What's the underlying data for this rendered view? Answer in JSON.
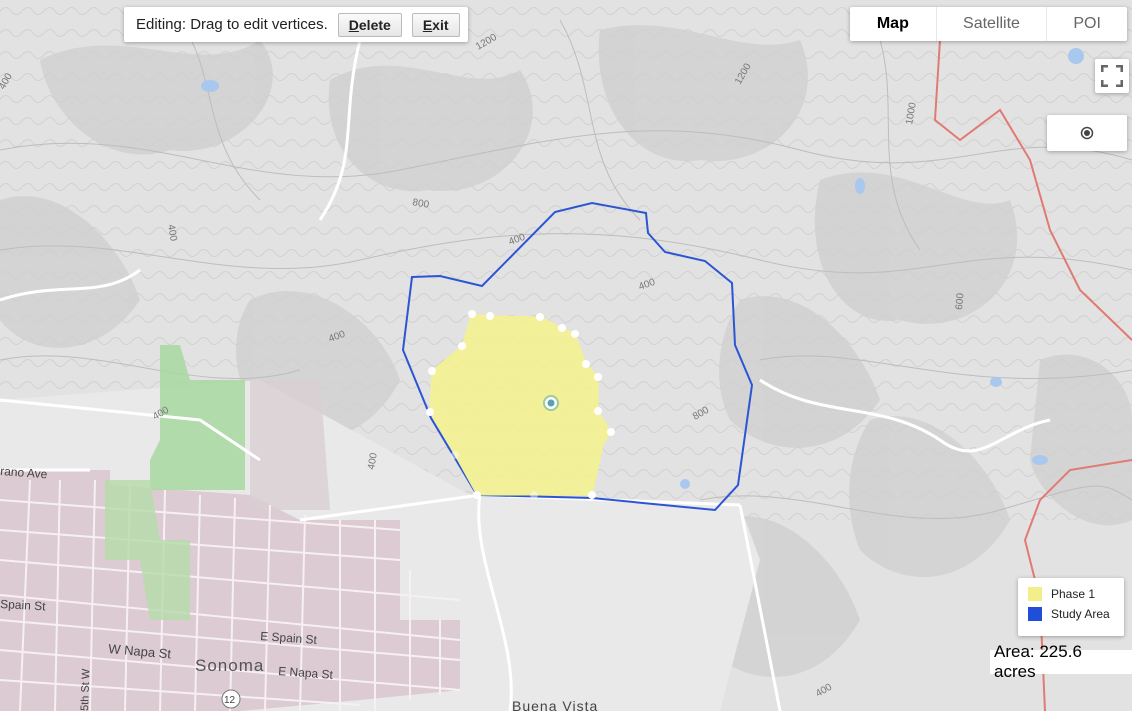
{
  "edit_toolbar": {
    "hint": "Editing: Drag to edit vertices.",
    "delete_label": "Delete",
    "exit_label": "Exit"
  },
  "map_type": {
    "options": [
      "Map",
      "Satellite",
      "POI"
    ],
    "active": "Map"
  },
  "controls": {
    "fullscreen_icon": "fullscreen-icon",
    "location_icon": "my-location-icon"
  },
  "map_labels": {
    "streets": [
      "rano Ave",
      "Spain St",
      "E Spain St",
      "W Napa St",
      "E Napa St",
      "5th St W",
      "Buena Vista"
    ],
    "town": "Sonoma",
    "route": "12",
    "contours": [
      "1200",
      "1200",
      "1000",
      "800",
      "400",
      "400",
      "600",
      "400",
      "800",
      "400",
      "400",
      "400",
      "400",
      "400"
    ]
  },
  "legend": {
    "items": [
      {
        "label": "Phase 1",
        "color": "#f2ef8a"
      },
      {
        "label": "Study Area",
        "color": "#1f4fd8"
      }
    ]
  },
  "area_readout": "Area: 225.6 acres",
  "colors": {
    "study_area_stroke": "#2c55d4",
    "phase_fill": "#f5f28b",
    "town_fill": "#dccbd2",
    "park_fill": "#a8d8a0",
    "terrain": "#dcdcdc",
    "road": "#ffffff",
    "highway": "#e07b73"
  }
}
